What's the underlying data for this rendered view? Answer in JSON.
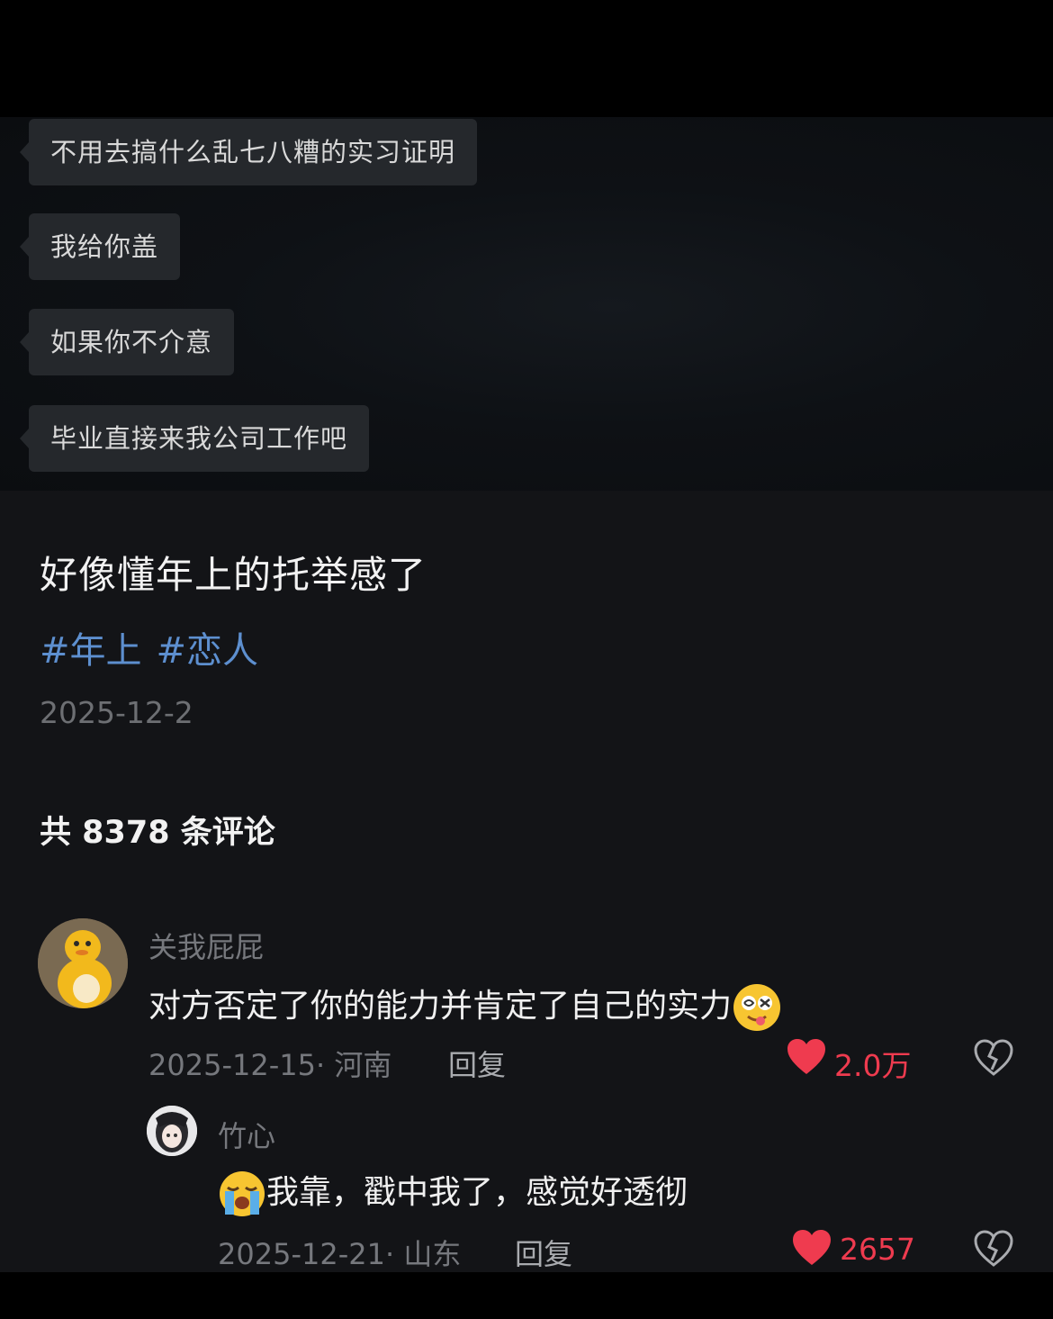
{
  "chat": {
    "messages": [
      "不用去搞什么乱七八糟的实习证明",
      "我给你盖",
      "如果你不介意",
      "毕业直接来我公司工作吧"
    ]
  },
  "post": {
    "title": "好像懂年上的托举感了",
    "tags": [
      "#年上",
      "#恋人"
    ],
    "date": "2025-12-2"
  },
  "comments_header": "共 8378 条评论",
  "comments": [
    {
      "username": "关我屁屁",
      "text": "对方否定了你的能力并肯定了自己的实力",
      "emoji": "dizzy-face-tongue-emoji",
      "meta": "2025-12-15· 河南",
      "reply_label": "回复",
      "likes": "2.0万",
      "like_color": "#ef3b4f"
    },
    {
      "username": "竹心",
      "text": "我靠，戳中我了，感觉好透彻",
      "emoji": "loudly-crying-face-emoji",
      "meta": "2025-12-21· 山东",
      "reply_label": "回复",
      "likes": "2657",
      "like_color": "#ef3b4f"
    }
  ],
  "colors": {
    "bubble": "#25282c",
    "tag": "#5d8fcf",
    "background": "#131417"
  }
}
